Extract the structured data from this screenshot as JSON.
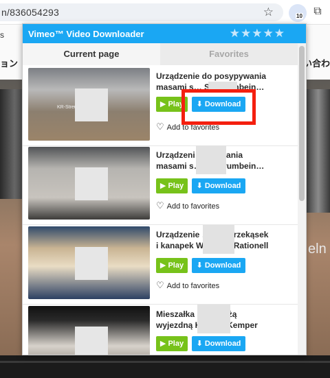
{
  "browser": {
    "url": "n/836054293",
    "extension_badge": "10"
  },
  "background": {
    "left_text_top": "s",
    "left_text_2": "ョン",
    "right_text": "い合わ",
    "video_word": "eln"
  },
  "popup": {
    "title": "Vimeo™ Video Downloader",
    "stars": "★★★★★",
    "tabs": [
      {
        "label": "Current page",
        "active": true
      },
      {
        "label": "Favorites",
        "active": false
      }
    ],
    "items": [
      {
        "title_line1": "Urządzenie do posypywania",
        "title_line2": "masami s… SS Krumbein…",
        "thumb_caption": "KR-Streum… Krumbein",
        "play_label": "▶ Play",
        "download_label": "⬇ Download",
        "favorite_label": "Add to favorites"
      },
      {
        "title_line1": "Urządzeni… ypywania",
        "title_line2": "masami s… SS Krumbein…",
        "play_label": "▶ Play",
        "download_label": "⬇ Download",
        "favorite_label": "Add to favorites"
      },
      {
        "title_line1": "Urządzenie … kcji przekąsek",
        "title_line2": "i kanapek W… bein Rationell",
        "play_label": "▶ Play",
        "download_label": "⬇ Download",
        "favorite_label": "Add to favorites"
      },
      {
        "title_line1": "Mieszałka s… dzieżą",
        "title_line2": "wyjezdną K… WP Kemper",
        "play_label": "▶ Play",
        "download_label": "⬇ Download"
      }
    ]
  },
  "colors": {
    "accent": "#1aa7f3",
    "play": "#77c21a",
    "highlight": "#f41f0f"
  }
}
